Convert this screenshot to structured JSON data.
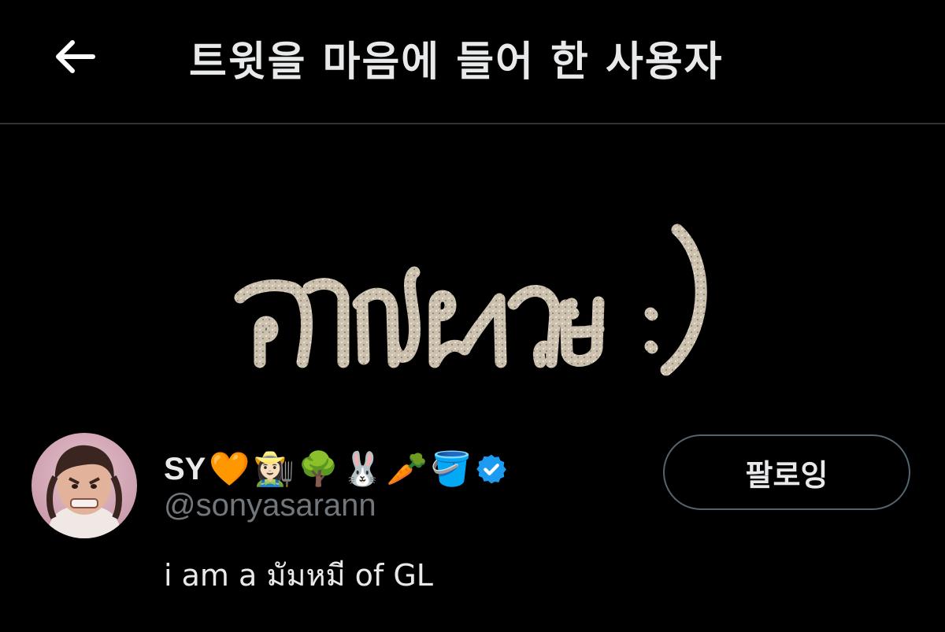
{
  "header": {
    "back_icon": "arrow-left-icon",
    "title": "트윗을 마음에 들어 한 사용자"
  },
  "tweet_media": {
    "handwritten_text": "อาหมวย :)",
    "text_color": "#cbbfae"
  },
  "user": {
    "display_name": "SY",
    "name_emojis": [
      "🧡",
      "👩🏻‍🌾",
      "🌳",
      "🐰",
      "🥕",
      "🪣"
    ],
    "verified_icon": "verified-badge-icon",
    "handle": "@sonyasarann",
    "bio": "i am a มัมหมี of GL",
    "follow_label": "팔로잉"
  },
  "colors": {
    "background": "#000000",
    "primary_text": "#e7e9ea",
    "secondary_text": "#71767b",
    "divider": "#2f3336",
    "verified_blue": "#1d9bf0",
    "button_border": "#536471"
  }
}
